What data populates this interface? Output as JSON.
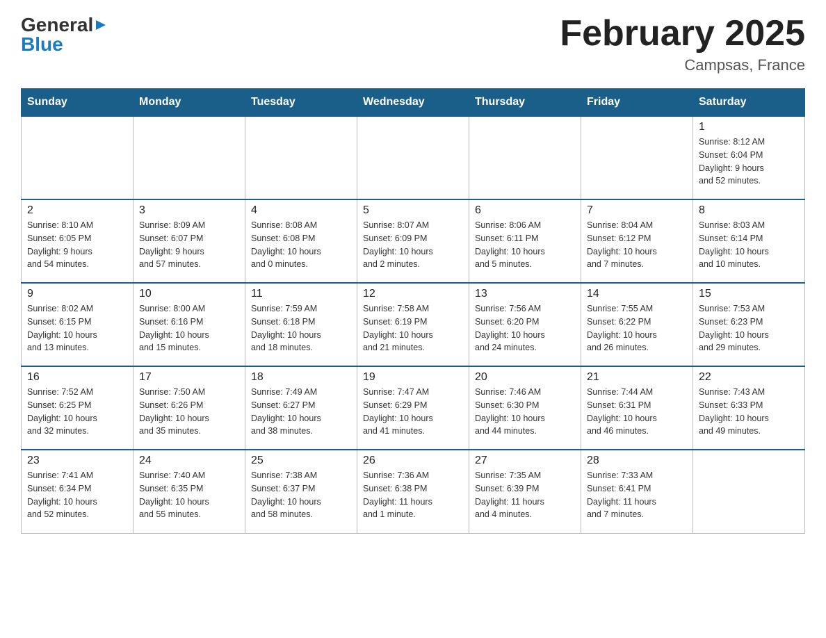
{
  "header": {
    "logo_general": "General",
    "logo_blue": "Blue",
    "month_title": "February 2025",
    "location": "Campsas, France"
  },
  "weekdays": [
    "Sunday",
    "Monday",
    "Tuesday",
    "Wednesday",
    "Thursday",
    "Friday",
    "Saturday"
  ],
  "weeks": [
    [
      {
        "day": "",
        "info": ""
      },
      {
        "day": "",
        "info": ""
      },
      {
        "day": "",
        "info": ""
      },
      {
        "day": "",
        "info": ""
      },
      {
        "day": "",
        "info": ""
      },
      {
        "day": "",
        "info": ""
      },
      {
        "day": "1",
        "info": "Sunrise: 8:12 AM\nSunset: 6:04 PM\nDaylight: 9 hours\nand 52 minutes."
      }
    ],
    [
      {
        "day": "2",
        "info": "Sunrise: 8:10 AM\nSunset: 6:05 PM\nDaylight: 9 hours\nand 54 minutes."
      },
      {
        "day": "3",
        "info": "Sunrise: 8:09 AM\nSunset: 6:07 PM\nDaylight: 9 hours\nand 57 minutes."
      },
      {
        "day": "4",
        "info": "Sunrise: 8:08 AM\nSunset: 6:08 PM\nDaylight: 10 hours\nand 0 minutes."
      },
      {
        "day": "5",
        "info": "Sunrise: 8:07 AM\nSunset: 6:09 PM\nDaylight: 10 hours\nand 2 minutes."
      },
      {
        "day": "6",
        "info": "Sunrise: 8:06 AM\nSunset: 6:11 PM\nDaylight: 10 hours\nand 5 minutes."
      },
      {
        "day": "7",
        "info": "Sunrise: 8:04 AM\nSunset: 6:12 PM\nDaylight: 10 hours\nand 7 minutes."
      },
      {
        "day": "8",
        "info": "Sunrise: 8:03 AM\nSunset: 6:14 PM\nDaylight: 10 hours\nand 10 minutes."
      }
    ],
    [
      {
        "day": "9",
        "info": "Sunrise: 8:02 AM\nSunset: 6:15 PM\nDaylight: 10 hours\nand 13 minutes."
      },
      {
        "day": "10",
        "info": "Sunrise: 8:00 AM\nSunset: 6:16 PM\nDaylight: 10 hours\nand 15 minutes."
      },
      {
        "day": "11",
        "info": "Sunrise: 7:59 AM\nSunset: 6:18 PM\nDaylight: 10 hours\nand 18 minutes."
      },
      {
        "day": "12",
        "info": "Sunrise: 7:58 AM\nSunset: 6:19 PM\nDaylight: 10 hours\nand 21 minutes."
      },
      {
        "day": "13",
        "info": "Sunrise: 7:56 AM\nSunset: 6:20 PM\nDaylight: 10 hours\nand 24 minutes."
      },
      {
        "day": "14",
        "info": "Sunrise: 7:55 AM\nSunset: 6:22 PM\nDaylight: 10 hours\nand 26 minutes."
      },
      {
        "day": "15",
        "info": "Sunrise: 7:53 AM\nSunset: 6:23 PM\nDaylight: 10 hours\nand 29 minutes."
      }
    ],
    [
      {
        "day": "16",
        "info": "Sunrise: 7:52 AM\nSunset: 6:25 PM\nDaylight: 10 hours\nand 32 minutes."
      },
      {
        "day": "17",
        "info": "Sunrise: 7:50 AM\nSunset: 6:26 PM\nDaylight: 10 hours\nand 35 minutes."
      },
      {
        "day": "18",
        "info": "Sunrise: 7:49 AM\nSunset: 6:27 PM\nDaylight: 10 hours\nand 38 minutes."
      },
      {
        "day": "19",
        "info": "Sunrise: 7:47 AM\nSunset: 6:29 PM\nDaylight: 10 hours\nand 41 minutes."
      },
      {
        "day": "20",
        "info": "Sunrise: 7:46 AM\nSunset: 6:30 PM\nDaylight: 10 hours\nand 44 minutes."
      },
      {
        "day": "21",
        "info": "Sunrise: 7:44 AM\nSunset: 6:31 PM\nDaylight: 10 hours\nand 46 minutes."
      },
      {
        "day": "22",
        "info": "Sunrise: 7:43 AM\nSunset: 6:33 PM\nDaylight: 10 hours\nand 49 minutes."
      }
    ],
    [
      {
        "day": "23",
        "info": "Sunrise: 7:41 AM\nSunset: 6:34 PM\nDaylight: 10 hours\nand 52 minutes."
      },
      {
        "day": "24",
        "info": "Sunrise: 7:40 AM\nSunset: 6:35 PM\nDaylight: 10 hours\nand 55 minutes."
      },
      {
        "day": "25",
        "info": "Sunrise: 7:38 AM\nSunset: 6:37 PM\nDaylight: 10 hours\nand 58 minutes."
      },
      {
        "day": "26",
        "info": "Sunrise: 7:36 AM\nSunset: 6:38 PM\nDaylight: 11 hours\nand 1 minute."
      },
      {
        "day": "27",
        "info": "Sunrise: 7:35 AM\nSunset: 6:39 PM\nDaylight: 11 hours\nand 4 minutes."
      },
      {
        "day": "28",
        "info": "Sunrise: 7:33 AM\nSunset: 6:41 PM\nDaylight: 11 hours\nand 7 minutes."
      },
      {
        "day": "",
        "info": ""
      }
    ]
  ]
}
